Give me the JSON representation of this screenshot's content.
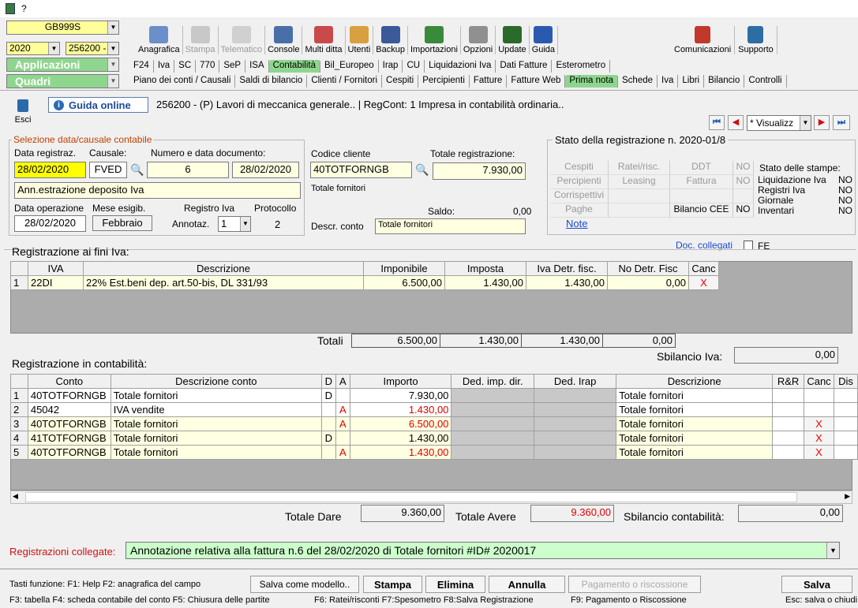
{
  "app": {
    "title": "?"
  },
  "top": {
    "company": "GB999S",
    "year": "2020",
    "code": "256200 -",
    "applicazioni": "Applicazioni",
    "quadri": "Quadri"
  },
  "toolbar": [
    {
      "label": "Anagrafica",
      "icon": "address-book-icon",
      "color": "#6b8fc8",
      "enabled": true
    },
    {
      "label": "Stampa",
      "icon": "printer-icon",
      "color": "#c8c8c8",
      "enabled": false
    },
    {
      "label": "Telematico",
      "icon": "telematic-icon",
      "color": "#d0d0d0",
      "enabled": false
    },
    {
      "label": "Console",
      "icon": "console-icon",
      "color": "#4a6fa8",
      "enabled": true
    },
    {
      "label": "Multi ditta",
      "icon": "multi-company-icon",
      "color": "#c84a4a",
      "enabled": true
    },
    {
      "label": "Utenti",
      "icon": "users-icon",
      "color": "#d8a040",
      "enabled": true
    },
    {
      "label": "Backup",
      "icon": "backup-icon",
      "color": "#3a5a9a",
      "enabled": true
    },
    {
      "label": "Importazioni",
      "icon": "import-icon",
      "color": "#3a8a3a",
      "enabled": true
    },
    {
      "label": "Opzioni",
      "icon": "wrench-icon",
      "color": "#909090",
      "enabled": true
    },
    {
      "label": "Update",
      "icon": "update-icon",
      "color": "#2a6a2a",
      "enabled": true
    },
    {
      "label": "Guida",
      "icon": "help-icon",
      "color": "#2a5ab0",
      "enabled": true
    }
  ],
  "toolbar_right": [
    {
      "label": "Comunicazioni",
      "icon": "communications-icon"
    },
    {
      "label": "Supporto",
      "icon": "support-icon"
    }
  ],
  "tabs1": [
    "F24",
    "Iva",
    "SC",
    "770",
    "SeP",
    "ISA",
    "Contabilità",
    "Bil_Europeo",
    "Irap",
    "CU",
    "Liquidazioni Iva",
    "Dati Fatture",
    "Esterometro"
  ],
  "tabs1_active": "Contabilità",
  "tabs2": [
    "Piano dei conti / Causali",
    "Saldi di bilancio",
    "Clienti / Fornitori",
    "Cespiti",
    "Percipienti",
    "Fatture",
    "Fatture Web",
    "Prima nota",
    "Schede",
    "Iva",
    "Libri",
    "Bilancio",
    "Controlli"
  ],
  "tabs2_active": "Prima nota",
  "header": {
    "esci": "Esci",
    "guida": "Guida online",
    "info": "256200 - (P) Lavori di meccanica generale.. | RegCont: 1 Impresa  in contabilità ordinaria..",
    "nav_select": "* Visualizz"
  },
  "sel": {
    "legend": "Selezione data/causale contabile",
    "data_reg_label": "Data registraz.",
    "causale_label": "Causale:",
    "num_doc_label": "Numero e data documento:",
    "data_reg": "28/02/2020",
    "causale": "FVED",
    "num_doc": "6",
    "data_doc": "28/02/2020",
    "descr": "Ann.estrazione deposito Iva",
    "data_op_label": "Data operazione",
    "mese_label": "Mese esigib.",
    "registro_label": "Registro Iva",
    "protocollo_label": "Protocollo",
    "data_op": "28/02/2020",
    "mese": "Febbraio",
    "annotaz_label": "Annotaz.",
    "annotaz": "1",
    "protocollo": "2"
  },
  "cli": {
    "label": "Codice cliente",
    "codice": "40TOTFORNGB",
    "nome": "Totale fornitori",
    "tot_label": "Totale registrazione:",
    "tot": "7.930,00",
    "saldo_label": "Saldo:",
    "saldo": "0,00",
    "descr_conto_label": "Descr. conto",
    "descr_conto": "Totale fornitori"
  },
  "stato": {
    "legend": "Stato della registrazione n. 2020-01/8",
    "cells": [
      [
        "Cespiti",
        "Ratei/risc.",
        "DDT",
        "NO"
      ],
      [
        "Percipienti",
        "Leasing",
        "Fattura",
        "NO"
      ],
      [
        "Corrispettivi",
        "",
        "",
        ""
      ],
      [
        "Paghe",
        "",
        "Bilancio CEE",
        "NO"
      ]
    ],
    "note": "Note",
    "stampe_title": "Stato delle stampe:",
    "stampe": [
      [
        "Liquidazione Iva",
        "NO"
      ],
      [
        "Registri Iva",
        "NO"
      ],
      [
        "Giornale",
        "NO"
      ],
      [
        "Inventari",
        "NO"
      ]
    ]
  },
  "doc": {
    "label": "Doc. collegati",
    "fe": "FE"
  },
  "iva": {
    "title": "Registrazione ai fini Iva:",
    "headers": [
      "IVA",
      "Descrizione",
      "Imponibile",
      "Imposta",
      "Iva Detr. fisc.",
      "No Detr. Fisc",
      "Canc"
    ],
    "rows": [
      [
        "1",
        "22DI",
        "22% Est.beni dep. art.50-bis, DL 331/93",
        "6.500,00",
        "1.430,00",
        "1.430,00",
        "0,00",
        "X"
      ]
    ],
    "totali_label": "Totali",
    "totali": [
      "6.500,00",
      "1.430,00",
      "1.430,00",
      "0,00"
    ],
    "sbil_label": "Sbilancio Iva:",
    "sbil": "0,00"
  },
  "cont": {
    "title": "Registrazione in contabilità:",
    "headers": [
      "Conto",
      "Descrizione conto",
      "D",
      "A",
      "Importo",
      "Ded. imp. dir.",
      "Ded. Irap",
      "Descrizione",
      "R&R",
      "Canc",
      "Dis"
    ],
    "rows": [
      {
        "n": "1",
        "conto": "40TOTFORNGB",
        "descr": "Totale fornitori",
        "d": "D",
        "a": "",
        "imp": "7.930,00",
        "desc2": "Totale fornitori",
        "canc": "",
        "red": false
      },
      {
        "n": "2",
        "conto": "45042",
        "descr": "IVA vendite",
        "d": "",
        "a": "A",
        "imp": "1.430,00",
        "desc2": "Totale fornitori",
        "canc": "",
        "red": true
      },
      {
        "n": "3",
        "conto": "40TOTFORNGB",
        "descr": "Totale fornitori",
        "d": "",
        "a": "A",
        "imp": "6.500,00",
        "desc2": "Totale fornitori",
        "canc": "X",
        "red": true
      },
      {
        "n": "4",
        "conto": "41TOTFORNGB",
        "descr": "Totale fornitori",
        "d": "D",
        "a": "",
        "imp": "1.430,00",
        "desc2": "Totale fornitori",
        "canc": "X",
        "red": false
      },
      {
        "n": "5",
        "conto": "40TOTFORNGB",
        "descr": "Totale fornitori",
        "d": "",
        "a": "A",
        "imp": "1.430,00",
        "desc2": "Totale fornitori",
        "canc": "X",
        "red": true
      }
    ],
    "tot_dare_label": "Totale Dare",
    "tot_dare": "9.360,00",
    "tot_avere_label": "Totale Avere",
    "tot_avere": "9.360,00",
    "sbil_label": "Sbilancio contabilità:",
    "sbil": "0,00"
  },
  "collegate": {
    "label": "Registrazioni collegate:",
    "value": "Annotazione relativa alla fattura n.6 del 28/02/2020 di Totale fornitori #ID# 2020017"
  },
  "footer": {
    "line1": "Tasti funzione: F1: Help  F2: anagrafica del campo",
    "line2": "F3: tabella  F4: scheda contabile del conto  F5: Chiusura delle partite",
    "line2b": "F6: Ratei/risconti  F7:Spesometro  F8:Salva Registrazione",
    "line2c": "F9: Pagamento o Riscossione",
    "salva_modello": "Salva come modello..",
    "stampa": "Stampa",
    "elimina": "Elimina",
    "annulla": "Annulla",
    "pagamento": "Pagamento o riscossione",
    "salva": "Salva",
    "esc": "Esc: salva o chiudi"
  }
}
